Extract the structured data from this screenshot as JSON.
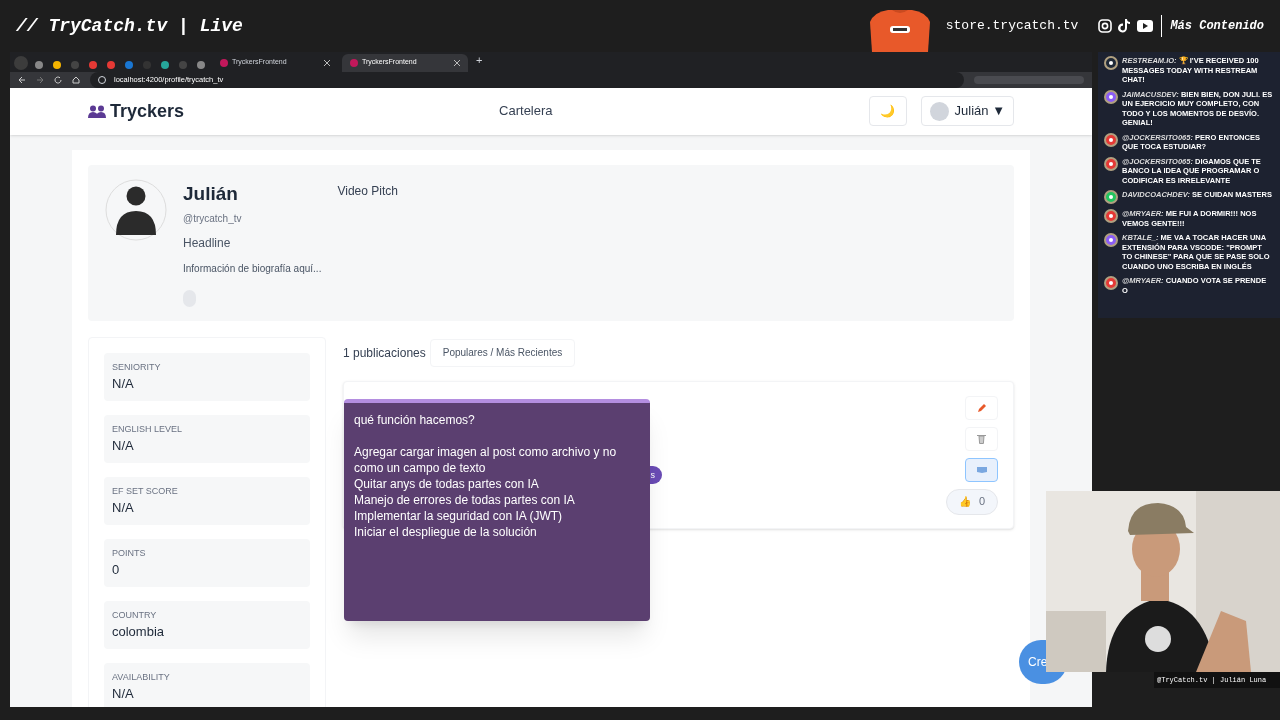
{
  "stream_header": {
    "title": "// TryCatch.tv | Live",
    "store": "store.trycatch.tv",
    "more": "Más Contenido"
  },
  "browser": {
    "tabs": [
      {
        "label": "TryckersFrontend",
        "selected": false
      },
      {
        "label": "TryckersFrontend",
        "selected": true
      }
    ],
    "new_tab": "+",
    "url": "localhost:4200/profile/trycatch_tv"
  },
  "navbar": {
    "brand": "Tryckers",
    "link": "Cartelera",
    "theme_icon": "🌙",
    "user": "Julián",
    "caret": "▼"
  },
  "profile": {
    "name": "Julián",
    "handle": "@trycatch_tv",
    "headline": "Headline",
    "bio": "Información de biografía aquí...",
    "video_pitch": "Video Pitch"
  },
  "stats": [
    {
      "label": "SENIORITY",
      "value": "N/A"
    },
    {
      "label": "ENGLISH LEVEL",
      "value": "N/A"
    },
    {
      "label": "EF SET SCORE",
      "value": "N/A"
    },
    {
      "label": "POINTS",
      "value": "0"
    },
    {
      "label": "COUNTRY",
      "value": "colombia"
    },
    {
      "label": "AVAILABILITY",
      "value": "N/A"
    }
  ],
  "posts": {
    "count": "1 publicaciones",
    "sort": "Populares / Más Recientes",
    "chip": "s",
    "likes": "0",
    "like_icon": "👍"
  },
  "note": {
    "question": "qué función hacemos?",
    "lines": [
      "Agregar cargar imagen al post como archivo y no como un campo de texto",
      "Quitar anys de todas partes con IA",
      "Manejo de errores de todas partes con IA",
      "Implementar la seguridad con IA (JWT)",
      "Iniciar el despliegue de la solución"
    ]
  },
  "fab": "Cre",
  "chat": [
    {
      "kind": "restream",
      "author": "RESTREAM.IO:",
      "text": "🏆 I'VE RECEIVED 100 MESSAGES TODAY WITH RESTREAM CHAT!"
    },
    {
      "kind": "twitch",
      "author": "JAIMACUSDEV:",
      "text": "BIEN BIEN, DON JULI. ES UN EJERCICIO MUY COMPLETO, CON TODO Y LOS MOMENTOS DE DESVÍO. GENIAL!"
    },
    {
      "kind": "youtube",
      "author": "@JOCKERSITO065:",
      "text": "PERO ENTONCES QUE TOCA ESTUDIAR?"
    },
    {
      "kind": "youtube",
      "author": "@JOCKERSITO065:",
      "text": "DIGAMOS QUE TE BANCO LA IDEA QUE PROGRAMAR O CODIFICAR ES IRRELEVANTE"
    },
    {
      "kind": "kick",
      "author": "DAVIDCOACHDEV:",
      "text": "SE CUIDAN MASTERS"
    },
    {
      "kind": "youtube",
      "author": "@MRYAER:",
      "text": "ME FUI A DORMIR!!! NOS VEMOS GENTE!!!"
    },
    {
      "kind": "twitch",
      "author": "KBTALE_:",
      "text": "ME VA A TOCAR HACER UNA EXTENSIÓN PARA VSCODE: \"PROMPT TO CHINESE\" PARA QUE SE PASE SOLO CUANDO UNO ESCRIBA EN INGLÉS"
    },
    {
      "kind": "youtube",
      "author": "@MRYAER:",
      "text": "CUANDO VOTA SE PRENDE O"
    }
  ],
  "webcam": {
    "caption": "@TryCatch.tv | Julián Luna"
  }
}
